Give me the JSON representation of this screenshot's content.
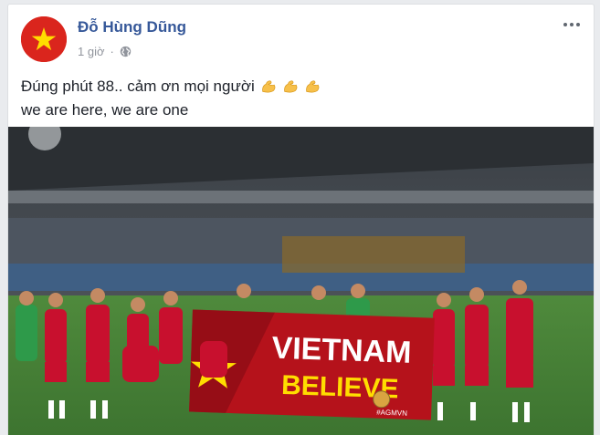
{
  "post": {
    "author_name": "Đỗ Hùng Dũng",
    "timestamp": "1 giờ",
    "separator": "·",
    "text_line1": "Đúng phút 88.. cảm ơn mọi người",
    "text_line2": "we are here, we are one",
    "emoji_count": 3
  },
  "photo": {
    "banner_line1": "VIETNAM",
    "banner_line2": "BELIEVE",
    "banner_hashtag": "#AGMVN"
  },
  "colors": {
    "link_blue": "#365899",
    "vietnam_red": "#da251d",
    "star_yellow": "#ffdd00",
    "banner_red": "#b5121b"
  },
  "icons": {
    "avatar": "vietnam-flag-avatar",
    "privacy": "globe-icon",
    "options": "more-options-icon",
    "emoji": "flexed-biceps-emoji"
  }
}
